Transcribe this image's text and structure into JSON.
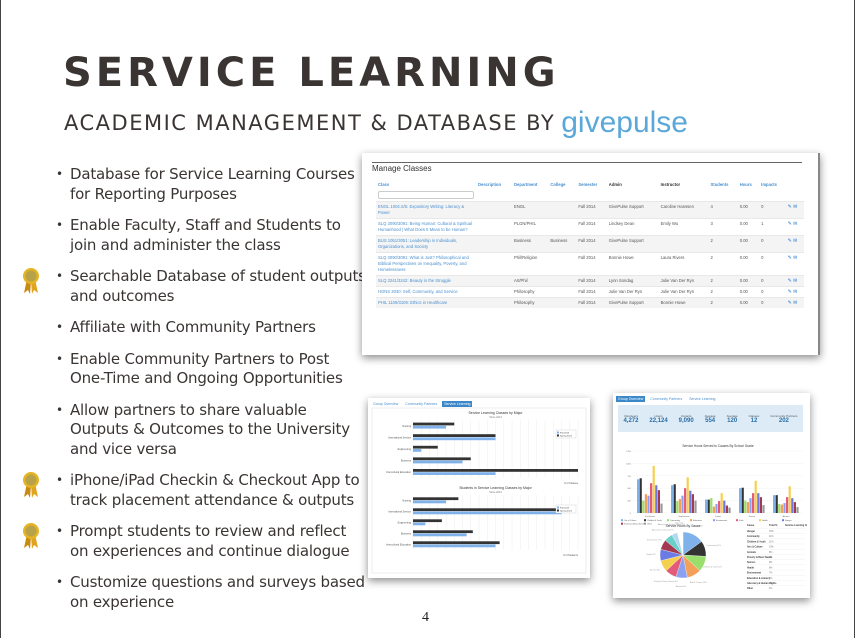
{
  "slide": {
    "title": "SERVICE LEARNING",
    "subtitle": "ACADEMIC MANAGEMENT & DATABASE BY",
    "brand": "givepulse",
    "page_number": "4",
    "colors": {
      "title": "#3a3533",
      "brand": "#5aa8d9",
      "link": "#4a90d0",
      "medal": "#d4a020"
    }
  },
  "bullets": [
    {
      "text": "Database for Service Learning Courses for Reporting Purposes",
      "medal": false
    },
    {
      "text": "Enable Faculty, Staff and Students to join and administer the class",
      "medal": false
    },
    {
      "text": "Searchable Database of student outputs and outcomes",
      "medal": true
    },
    {
      "text": "Affiliate with Community Partners",
      "medal": false
    },
    {
      "text": "Enable Community Partners to Post One-Time and Ongoing Opportunities",
      "medal": false
    },
    {
      "text": "Allow partners to share valuable Outputs & Outcomes to the University and vice versa",
      "medal": false
    },
    {
      "text": "iPhone/iPad Checkin & Checkout App to track placement attendance & outputs",
      "medal": true
    },
    {
      "text": "Prompt students to review and reflect on experiences and continue dialogue",
      "medal": true
    },
    {
      "text": "Customize questions and surveys based on experience",
      "medal": false
    }
  ],
  "manage_classes": {
    "title": "Manage Classes",
    "columns": [
      "Class",
      "Description",
      "Department",
      "College",
      "Semester",
      "Admin",
      "Instructor",
      "Students",
      "Hours",
      "Impacts"
    ],
    "rows": [
      {
        "class": "ENGL 1004.S/5: Expository Writing: Literacy & Power",
        "description": "",
        "department": "ENGL",
        "college": "",
        "semester": "Fall 2014",
        "admin": "GivePulse Support",
        "instructor": "Caroline Hanssen",
        "students": "4",
        "hours": "0.00",
        "impacts": "0"
      },
      {
        "class": "SLQ 3090/3091: Being Human: Cultural & Spiritual Humanhood | What Does It Mean to be Human?",
        "description": "",
        "department": "PLGN/PHIL",
        "college": "",
        "semester": "Fall 2014",
        "admin": "Lindsey Dean",
        "instructor": "Emily Wu",
        "students": "3",
        "hours": "0.00",
        "impacts": "1"
      },
      {
        "class": "BUS 1051/3051: Leadership in Individuals, Organizations, and Society",
        "description": "",
        "department": "Business",
        "college": "Business",
        "semester": "Fall 2014",
        "admin": "GivePulse Support",
        "instructor": "",
        "students": "2",
        "hours": "0.00",
        "impacts": "0"
      },
      {
        "class": "SLQ 3090/3091: What is Just? Philosophical and Biblical Perspectives on Inequality, Poverty, and Homelessness",
        "description": "",
        "department": "Phil/Religion",
        "college": "",
        "semester": "Fall 2014",
        "admin": "Bonnie Howe",
        "instructor": "Laura Rivers",
        "students": "2",
        "hours": "0.00",
        "impacts": "0"
      },
      {
        "class": "SLQ 3241/3242: Beauty in the Struggle",
        "description": "",
        "department": "Art/Phil",
        "college": "",
        "semester": "Fall 2014",
        "admin": "Lynn Sondag",
        "instructor": "Julie Van Der Ryn",
        "students": "2",
        "hours": "0.00",
        "impacts": "0"
      },
      {
        "class": "HONS 3030: Self, Community, and Service",
        "description": "",
        "department": "Philosophy",
        "college": "",
        "semester": "Fall 2014",
        "admin": "Julie Van Der Ryn",
        "instructor": "Julie Van Der Ryn",
        "students": "2",
        "hours": "0.00",
        "impacts": "0"
      },
      {
        "class": "PHIL 1109/3109: Ethics in Healthcare",
        "description": "",
        "department": "Philosophy",
        "college": "",
        "semester": "Fall 2014",
        "admin": "GivePulse Support",
        "instructor": "Bonnie Howe",
        "students": "2",
        "hours": "0.00",
        "impacts": "0"
      }
    ],
    "actions": {
      "edit_icon": "pencil-icon",
      "email_icon": "envelope-icon"
    }
  },
  "service_learning_panel": {
    "tabs": [
      "Group Overview",
      "Community Partners",
      "Service Learning"
    ],
    "active_tab": 2
  },
  "overview_panel": {
    "tabs": [
      "Group Overview",
      "Community Partners",
      "Service Learning"
    ],
    "active_tab": 0,
    "stats": [
      {
        "label": "Volunteers",
        "value": "4,272"
      },
      {
        "label": "Hours",
        "value": "22,124"
      },
      {
        "label": "Impacts",
        "value": "9,090"
      },
      {
        "label": "Average",
        "value": "554"
      },
      {
        "label": "Average",
        "value": "120"
      },
      {
        "label": "Classes",
        "value": "12"
      },
      {
        "label": "Community Partners",
        "value": "202"
      }
    ]
  },
  "chart_data": [
    {
      "type": "bar",
      "title": "Service Learning Classes by Major",
      "subtitle": "Since 2013",
      "orientation": "horizontal",
      "categories": [
        "Nursing",
        "International Service",
        "Engineering",
        "Business",
        "Intercultural Education"
      ],
      "series": [
        {
          "name": "Fall 2013",
          "values": [
            4,
            10,
            1,
            6,
            10
          ]
        },
        {
          "name": "Spring 2014",
          "values": [
            5,
            10,
            3,
            7,
            20
          ]
        }
      ],
      "xlabel": "# of Classes",
      "xlim": [
        0,
        20
      ],
      "legend": "right"
    },
    {
      "type": "bar",
      "title": "Students in Service Learning Classes by Major",
      "subtitle": "Since 2013",
      "orientation": "horizontal",
      "categories": [
        "Nursing",
        "International Service",
        "Engineering",
        "Business",
        "Intercultural Education"
      ],
      "series": [
        {
          "name": "Fall 2013",
          "values": [
            80,
            360,
            30,
            130,
            200
          ]
        },
        {
          "name": "Spring 2014",
          "values": [
            110,
            365,
            70,
            145,
            210
          ]
        }
      ],
      "xlabel": "# of Students",
      "xlim": [
        0,
        400
      ],
      "legend": "right"
    },
    {
      "type": "bar",
      "title": "Service Hours Served to Causes By School Grade",
      "categories": [
        "Freshman",
        "Sophomore",
        "Junior",
        "Senior",
        "Alumni"
      ],
      "series": [
        {
          "name": "Out of Culture",
          "values": [
            680,
            560,
            270,
            500,
            360
          ]
        },
        {
          "name": "Children & Youth",
          "values": [
            700,
            580,
            270,
            510,
            360
          ]
        },
        {
          "name": "Community",
          "values": [
            250,
            240,
            300,
            250,
            180
          ]
        },
        {
          "name": "Education",
          "values": [
            380,
            280,
            130,
            220,
            170
          ]
        },
        {
          "name": "Environment",
          "values": [
            350,
            350,
            180,
            300,
            200
          ]
        },
        {
          "name": "Faith",
          "values": [
            600,
            500,
            240,
            400,
            320
          ]
        },
        {
          "name": "Health",
          "values": [
            950,
            720,
            400,
            650,
            540
          ]
        },
        {
          "name": "Hunger",
          "values": [
            560,
            450,
            250,
            400,
            300
          ]
        },
        {
          "name": "Poverty & Basic Needs",
          "values": [
            460,
            380,
            150,
            320,
            220
          ]
        },
        {
          "name": "Other",
          "values": [
            190,
            250,
            110,
            160,
            120
          ]
        }
      ],
      "ylim": [
        0,
        1250
      ],
      "legend": "bottom"
    },
    {
      "type": "pie",
      "title": "Service Hours By Cause",
      "categories": [
        "Hunger",
        "Community",
        "Children & Youth",
        "Arts & Culture",
        "Animals",
        "Poverty & Basic Needs",
        "Seniors",
        "Health",
        "Environment",
        "Education & Literacy",
        "Advocacy & Human Rights",
        "Other"
      ],
      "values": [
        15,
        11,
        11,
        10,
        8,
        8,
        8,
        8,
        7,
        6,
        4,
        4
      ]
    }
  ]
}
